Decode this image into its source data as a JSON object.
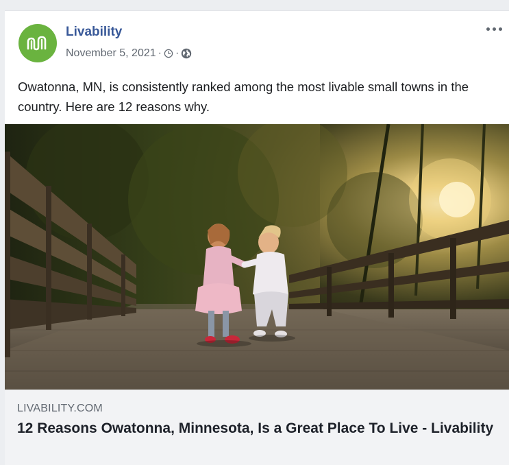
{
  "post": {
    "page_name": "Livability",
    "date": "November 5, 2021",
    "separator": "·",
    "text": "Owatonna, MN, is consistently ranked among the most livable small towns in the country. Here are 12 reasons why."
  },
  "link_preview": {
    "domain": "LIVABILITY.COM",
    "title": "12 Reasons Owatonna, Minnesota, Is a Great Place To Live - Livability"
  },
  "icons": {
    "avatar": "livability-logo-icon",
    "clock": "clock-icon",
    "audience": "globe-icon",
    "more": "more-options-icon"
  },
  "colors": {
    "page_name": "#385898",
    "logo_green": "#6ab33f",
    "footer_bg": "#f2f3f5"
  }
}
